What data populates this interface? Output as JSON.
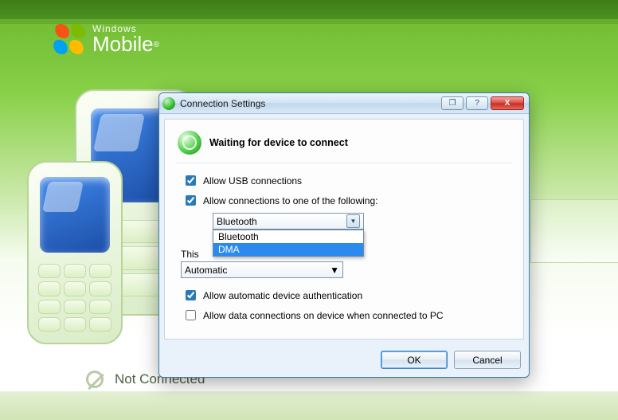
{
  "brand": {
    "line1": "Windows",
    "line2": "Mobile",
    "reg": "®"
  },
  "status": {
    "text": "Not Connected"
  },
  "dialog": {
    "title": "Connection Settings",
    "header": "Waiting for device to connect",
    "allow_usb": {
      "label": "Allow USB connections",
      "checked": true
    },
    "allow_one": {
      "label": "Allow connections to one of the following:",
      "checked": true
    },
    "combo1": {
      "selected": "Bluetooth",
      "options": [
        "Bluetooth",
        "DMA"
      ],
      "highlighted_index": 1
    },
    "this_label": "This",
    "combo2": {
      "selected": "Automatic"
    },
    "auto_auth": {
      "label": "Allow automatic device authentication",
      "checked": true
    },
    "data_conn": {
      "label": "Allow data connections on device when connected to PC",
      "checked": false
    },
    "ok": "OK",
    "cancel": "Cancel",
    "help_glyph": "?",
    "close_glyph": "X",
    "restore_glyph": "❐"
  }
}
